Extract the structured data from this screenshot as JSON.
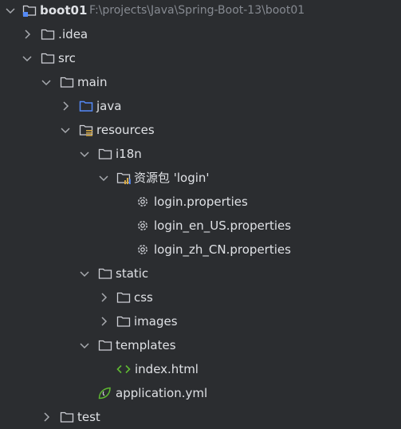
{
  "tree": {
    "root": {
      "name": "boot01",
      "path": "F:\\projects\\Java\\Spring-Boot-13\\boot01"
    },
    "idea": "idea",
    "src": "src",
    "main": "main",
    "java": "java",
    "resources": "resources",
    "i18n": "i18n",
    "bundle": "资源包 'login'",
    "login_props": "login.properties",
    "login_en": "login_en_US.properties",
    "login_zh": "login_zh_CN.properties",
    "static": "static",
    "css": "css",
    "images": "images",
    "templates": "templates",
    "index": "index.html",
    "app_yml": "application.yml",
    "test": "test"
  },
  "colors": {
    "background": "#2b2d30",
    "text": "#dfe1e5",
    "path_text": "#868a91",
    "source_folder": "#548af7",
    "resource_bars": "#d6a945",
    "spring_leaf": "#5fb832",
    "html_tag": "#5fb832"
  },
  "icons": [
    "chevron-down-icon",
    "chevron-right-icon",
    "module-folder-icon",
    "folder-icon",
    "source-folder-icon",
    "resources-folder-icon",
    "resource-bundle-icon",
    "properties-gear-icon",
    "html-file-icon",
    "spring-yaml-icon"
  ]
}
